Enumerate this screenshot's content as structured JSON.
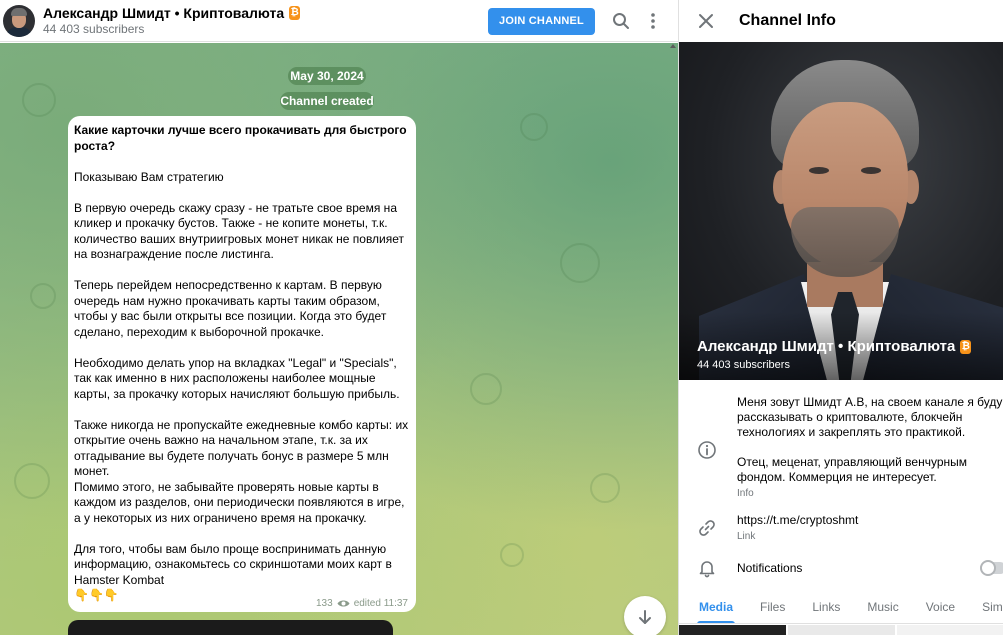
{
  "channel": {
    "name": "Александр Шмидт • Криптовалюта",
    "badge": "₿",
    "subscribers": "44 403 subscribers"
  },
  "header": {
    "join_label": "JOIN CHANNEL"
  },
  "chat": {
    "date": "May 30, 2024",
    "service": "Channel created",
    "message": {
      "question": "Какие карточки лучше всего прокачивать для быстрого роста?",
      "paragraphs": [
        "Показываю Вам стратегию",
        "В первую очередь скажу сразу - не тратьте свое время на кликер и прокачку бустов. Также - не копите монеты, т.к. количество ваших внутриигровых монет никак не повлияет на вознаграждение после листинга.",
        "Теперь перейдем непосредственно к картам. В первую очередь нам нужно прокачивать карты таким образом, чтобы у вас были открыты все позиции. Когда это будет сделано, переходим к выборочной прокачке.",
        "Необходимо делать упор на вкладках \"Legal\" и \"Specials\", так как именно в них расположены наиболее мощные карты, за прокачку которых начисляют большую прибыль.",
        "Также никогда не пропускайте ежедневные комбо карты: их открытие очень важно на начальном этапе, т.к. за их отгадывание вы будете получать бонус в размере 5 млн монет.",
        "Помимо этого, не забывайте проверять новые карты в каждом из разделов, они периодически появляются в игре, а у некоторых из них ограничено время на прокачку.",
        "Для того, чтобы вам было проще воспринимать данную информацию, ознакомьтесь со скриншотами моих карт в Hamster Kombat"
      ],
      "emojis": "👇👇👇",
      "views": "133",
      "edited": "edited 11:37"
    }
  },
  "info_panel": {
    "title": "Channel Info",
    "about": "Меня зовут Шмидт А.В, на своем канале я буду рассказывать о криптовалюте, блокчейн технологиях и закреплять это практикой.",
    "about2": "Отец, меценат, управляющий венчурным фондом. Коммерция не интересует.",
    "about_label": "Info",
    "link": "https://t.me/cryptoshmt",
    "link_label": "Link",
    "notifications": "Notifications",
    "notifications_on": false,
    "tabs": [
      "Media",
      "Files",
      "Links",
      "Music",
      "Voice",
      "Sim"
    ]
  },
  "colors": {
    "accent": "#3390ec",
    "badge": "#f7931a"
  }
}
